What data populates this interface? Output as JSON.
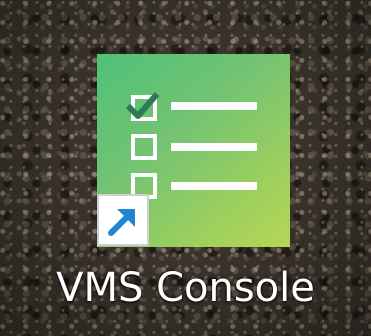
{
  "desktop_icon": {
    "label": "VMS Console",
    "icon": "checklist-icon",
    "overlay_icon": "shortcut-arrow-icon",
    "colors": {
      "tile_gradient_start": "#4ec178",
      "tile_gradient_end": "#b6d655",
      "check_mark": "#2f7a55",
      "arrow": "#1e86d0"
    }
  }
}
